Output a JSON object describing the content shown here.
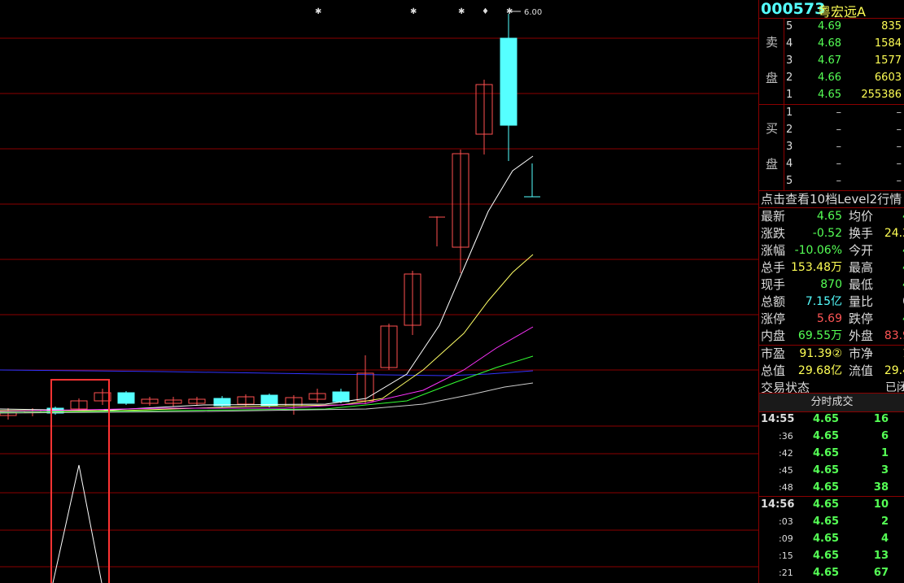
{
  "chart": {
    "peak_label": "6.00",
    "star_markers": [
      "*",
      "*",
      "*",
      "*"
    ],
    "price_max": 6.0,
    "price_min": 4.0
  },
  "stock": {
    "code": "000573",
    "name": "粤宏远A"
  },
  "order_book": {
    "sell_label_1": "卖",
    "sell_label_2": "盘",
    "buy_label_1": "买",
    "buy_label_2": "盘",
    "sell": [
      {
        "level": "5",
        "price": "4.69",
        "volume": "835"
      },
      {
        "level": "4",
        "price": "4.68",
        "volume": "1584"
      },
      {
        "level": "3",
        "price": "4.67",
        "volume": "1577"
      },
      {
        "level": "2",
        "price": "4.66",
        "volume": "6603"
      },
      {
        "level": "1",
        "price": "4.65",
        "volume": "255386"
      }
    ],
    "buy": [
      {
        "level": "1",
        "price": "–",
        "volume": "–"
      },
      {
        "level": "2",
        "price": "–",
        "volume": "–"
      },
      {
        "level": "3",
        "price": "–",
        "volume": "–"
      },
      {
        "level": "4",
        "price": "–",
        "volume": "–"
      },
      {
        "level": "5",
        "price": "–",
        "volume": "–"
      }
    ]
  },
  "level2_link": "点击查看10档Level2行情",
  "stats": {
    "latest_k": "最新",
    "latest_v": "4.65",
    "avg_k": "均价",
    "avg_v": "4",
    "change_k": "涨跌",
    "change_v": "-0.52",
    "turnover_k": "换手",
    "turnover_v": "24.2",
    "pct_k": "涨幅",
    "pct_v": "-10.06%",
    "open_k": "今开",
    "open_v": "4",
    "vol_k": "总手",
    "vol_v": "153.48万",
    "high_k": "最高",
    "high_v": "4",
    "cur_k": "现手",
    "cur_v": "870",
    "low_k": "最低",
    "low_v": "4",
    "amount_k": "总额",
    "amount_v": "7.15亿",
    "ratio_k": "量比",
    "ratio_v": "0",
    "limitup_k": "涨停",
    "limitup_v": "5.69",
    "limitdown_k": "跌停",
    "limitdown_v": "4",
    "inner_k": "内盘",
    "inner_v": "69.55万",
    "outer_k": "外盘",
    "outer_v": "83.9",
    "pe_k": "市盈",
    "pe_v": "91.39②",
    "pb_k": "市净",
    "pb_v": "1",
    "mktcap_k": "总值",
    "mktcap_v": "29.68亿",
    "float_k": "流值",
    "float_v": "29.4",
    "status_k": "交易状态",
    "status_v": "已闭"
  },
  "ticks_title": "分时成交",
  "ticks": [
    {
      "time": "14:55",
      "sec": "",
      "price": "4.65",
      "qty": "16"
    },
    {
      "time": "",
      "sec": ":36",
      "price": "4.65",
      "qty": "6"
    },
    {
      "time": "",
      "sec": ":42",
      "price": "4.65",
      "qty": "1"
    },
    {
      "time": "",
      "sec": ":45",
      "price": "4.65",
      "qty": "3"
    },
    {
      "time": "",
      "sec": ":48",
      "price": "4.65",
      "qty": "38"
    },
    {
      "time": "14:56",
      "sec": "",
      "price": "4.65",
      "qty": "10"
    },
    {
      "time": "",
      "sec": ":03",
      "price": "4.65",
      "qty": "2"
    },
    {
      "time": "",
      "sec": ":09",
      "price": "4.65",
      "qty": "4"
    },
    {
      "time": "",
      "sec": ":15",
      "price": "4.65",
      "qty": "13"
    },
    {
      "time": "",
      "sec": ":21",
      "price": "4.65",
      "qty": "67"
    }
  ],
  "colors": {
    "grid": "#8b0000",
    "up": "#ff5050",
    "down": "#55ffff",
    "ma5": "#ffffff",
    "ma10": "#ffff66",
    "ma20": "#ff33ff",
    "ma30": "#33ff33",
    "ma60": "#cccccc",
    "blue_line": "#3333ff",
    "highlight_box": "#ff3333"
  }
}
